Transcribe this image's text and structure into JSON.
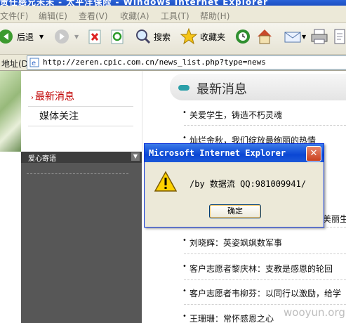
{
  "window": {
    "title": "责任感兄未未 - 太平洋保险 - Windows Internet Explorer"
  },
  "menu": {
    "items": [
      "文件(F)",
      "编辑(E)",
      "查看(V)",
      "收藏(A)",
      "工具(T)",
      "帮助(H)"
    ]
  },
  "toolbar": {
    "back_label": "后退",
    "search_label": "搜索",
    "favorites_label": "收藏夹"
  },
  "address": {
    "label": "地址(D)",
    "url": "http://zeren.cpic.com.cn/news_list.php?type=news"
  },
  "sidebar": {
    "items": [
      {
        "label": "最新消息"
      },
      {
        "label": "媒体关注"
      }
    ],
    "panel_title": "爱心寄语"
  },
  "main": {
    "heading": "最新消息",
    "news": [
      "关爱学生，铸造不朽灵魂",
      "灿烂金秋，我们绽放最绚丽的热情",
      "美丽生",
      "刘晓辉：英姿飒飒数军事",
      "客户志愿者黎庆林：支教是感恩的轮回",
      "客户志愿者韦柳芬：以同行以激励，给学",
      "王珊珊：常怀感恩之心"
    ]
  },
  "dialog": {
    "title": "Microsoft Internet Explorer",
    "message": "/by 数据流 QQ:981009941/",
    "ok_label": "确定"
  },
  "watermark": "wooyun.org",
  "colors": {
    "dialog_title": "#0a46d4",
    "accent_teal": "#2b9fa8",
    "nav_active": "#c00000"
  }
}
